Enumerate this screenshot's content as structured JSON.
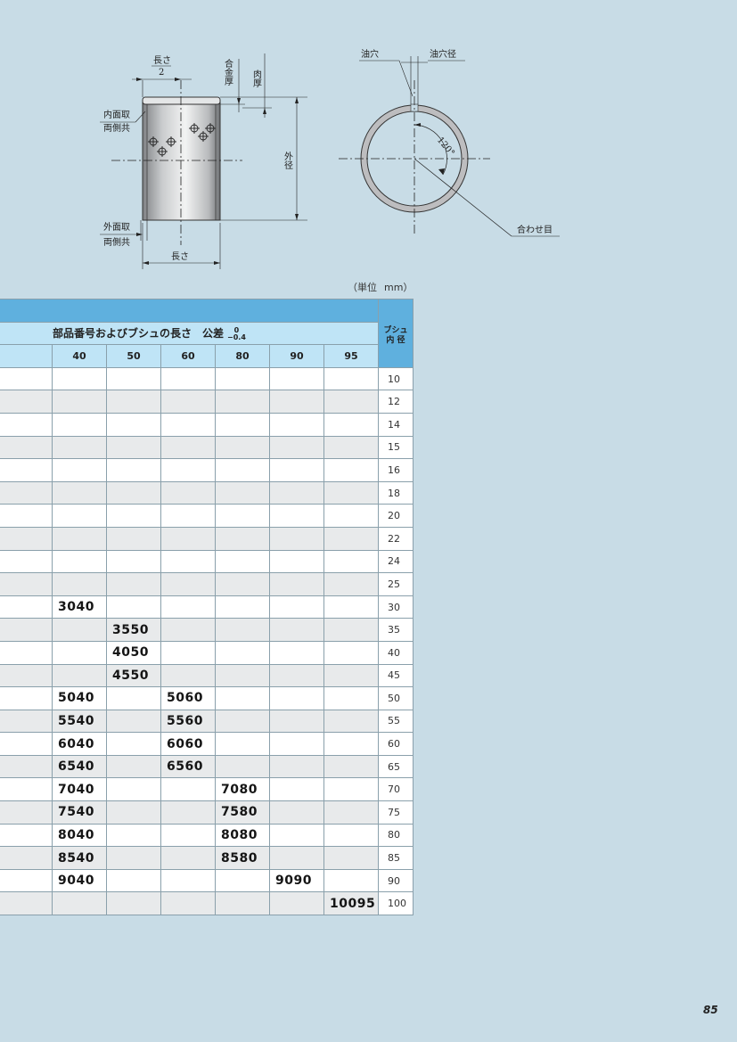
{
  "diagram": {
    "labels": {
      "half_length": "長さ",
      "half_divisor": "2",
      "alloy_thickness": "合金厚",
      "wall_thickness": "肉厚",
      "inner_chamfer_line1": "内面取",
      "inner_chamfer_line2": "両側共",
      "outer_chamfer_line1": "外面取",
      "outer_chamfer_line2": "両側共",
      "length": "長さ",
      "outer_diameter": "外径",
      "oil_hole": "油穴",
      "oil_hole_diameter": "油穴径",
      "angle": "120°",
      "seam": "合わせ目"
    }
  },
  "unit_label": "（単位",
  "unit_value": "mm）",
  "table": {
    "header_title": "部品番号およびブシュの長さ　公差",
    "tolerance_upper": "0",
    "tolerance_lower": "−0.4",
    "bush_id_line1": "ブシュ",
    "bush_id_line2": "内 径",
    "lengths": [
      "40",
      "50",
      "60",
      "80",
      "90",
      "95"
    ],
    "rows": [
      {
        "id": "10",
        "cells": [
          "",
          "",
          "",
          "",
          "",
          ""
        ]
      },
      {
        "id": "12",
        "cells": [
          "",
          "",
          "",
          "",
          "",
          ""
        ]
      },
      {
        "id": "14",
        "cells": [
          "",
          "",
          "",
          "",
          "",
          ""
        ]
      },
      {
        "id": "15",
        "cells": [
          "",
          "",
          "",
          "",
          "",
          ""
        ]
      },
      {
        "id": "16",
        "cells": [
          "",
          "",
          "",
          "",
          "",
          ""
        ]
      },
      {
        "id": "18",
        "cells": [
          "",
          "",
          "",
          "",
          "",
          ""
        ]
      },
      {
        "id": "20",
        "cells": [
          "",
          "",
          "",
          "",
          "",
          ""
        ]
      },
      {
        "id": "22",
        "cells": [
          "",
          "",
          "",
          "",
          "",
          ""
        ]
      },
      {
        "id": "24",
        "cells": [
          "",
          "",
          "",
          "",
          "",
          ""
        ]
      },
      {
        "id": "25",
        "cells": [
          "",
          "",
          "",
          "",
          "",
          ""
        ]
      },
      {
        "id": "30",
        "cells": [
          "3040",
          "",
          "",
          "",
          "",
          ""
        ]
      },
      {
        "id": "35",
        "cells": [
          "",
          "3550",
          "",
          "",
          "",
          ""
        ]
      },
      {
        "id": "40",
        "cells": [
          "",
          "4050",
          "",
          "",
          "",
          ""
        ]
      },
      {
        "id": "45",
        "cells": [
          "",
          "4550",
          "",
          "",
          "",
          ""
        ]
      },
      {
        "id": "50",
        "cells": [
          "5040",
          "",
          "5060",
          "",
          "",
          ""
        ]
      },
      {
        "id": "55",
        "cells": [
          "5540",
          "",
          "5560",
          "",
          "",
          ""
        ]
      },
      {
        "id": "60",
        "cells": [
          "6040",
          "",
          "6060",
          "",
          "",
          ""
        ]
      },
      {
        "id": "65",
        "cells": [
          "6540",
          "",
          "6560",
          "",
          "",
          ""
        ]
      },
      {
        "id": "70",
        "cells": [
          "7040",
          "",
          "",
          "7080",
          "",
          ""
        ]
      },
      {
        "id": "75",
        "cells": [
          "7540",
          "",
          "",
          "7580",
          "",
          ""
        ]
      },
      {
        "id": "80",
        "cells": [
          "8040",
          "",
          "",
          "8080",
          "",
          ""
        ]
      },
      {
        "id": "85",
        "cells": [
          "8540",
          "",
          "",
          "8580",
          "",
          ""
        ]
      },
      {
        "id": "90",
        "cells": [
          "9040",
          "",
          "",
          "",
          "9090",
          ""
        ]
      },
      {
        "id": "100",
        "cells": [
          "",
          "",
          "",
          "",
          "",
          "10095"
        ]
      }
    ]
  },
  "page_number": "85"
}
